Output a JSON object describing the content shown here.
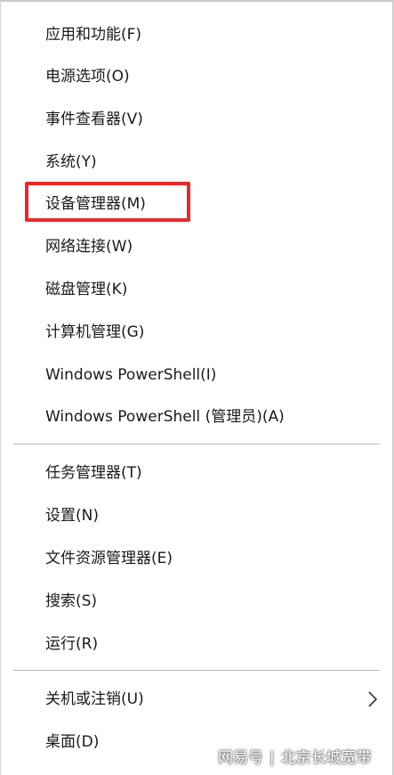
{
  "menu": {
    "group1": [
      {
        "label": "应用和功能(F)"
      },
      {
        "label": "电源选项(O)"
      },
      {
        "label": "事件查看器(V)"
      },
      {
        "label": "系统(Y)"
      },
      {
        "label": "设备管理器(M)"
      },
      {
        "label": "网络连接(W)"
      },
      {
        "label": "磁盘管理(K)"
      },
      {
        "label": "计算机管理(G)"
      },
      {
        "label": "Windows PowerShell(I)"
      },
      {
        "label": "Windows PowerShell (管理员)(A)"
      }
    ],
    "group2": [
      {
        "label": "任务管理器(T)"
      },
      {
        "label": "设置(N)"
      },
      {
        "label": "文件资源管理器(E)"
      },
      {
        "label": "搜索(S)"
      },
      {
        "label": "运行(R)"
      }
    ],
    "group3": [
      {
        "label": "关机或注销(U)"
      },
      {
        "label": "桌面(D)"
      }
    ]
  },
  "highlight": {
    "target": "设备管理器(M)",
    "color": "#e52a2a"
  },
  "submenu_icon": "chevron-right-icon",
  "watermark": {
    "left": "网易号",
    "separator": "|",
    "right": "北京长城宽带"
  }
}
